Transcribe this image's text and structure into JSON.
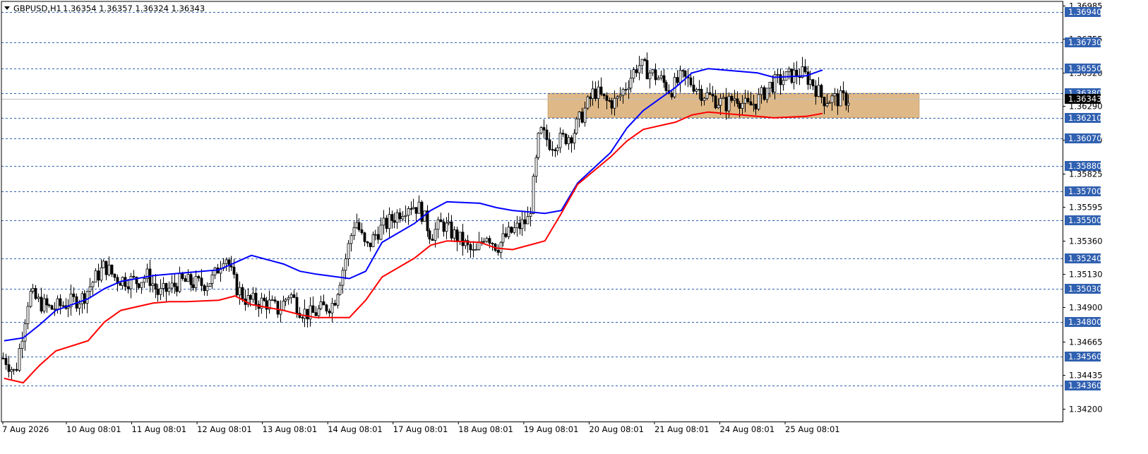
{
  "header": {
    "symbol": "GBPUSD,H1",
    "ohlc": "1.36354 1.36357 1.36324 1.36343"
  },
  "chart_data": {
    "type": "candlestick",
    "symbol": "GBPUSD",
    "timeframe": "H1",
    "last_price": "1.36343",
    "ylim": [
      1.4195,
      1.37095
    ],
    "y_ticks": [
      "1.36985",
      "1.36755",
      "1.36520",
      "1.36290",
      "1.36060",
      "1.35825",
      "1.35595",
      "1.35360",
      "1.35130",
      "1.34900",
      "1.34665",
      "1.34435",
      "1.34200"
    ],
    "x_ticks": [
      "7 Aug 2026",
      "10 Aug 08:01",
      "11 Aug 08:01",
      "12 Aug 08:01",
      "13 Aug 08:01",
      "14 Aug 08:01",
      "17 Aug 08:01",
      "18 Aug 08:01",
      "19 Aug 08:01",
      "20 Aug 08:01",
      "21 Aug 08:01",
      "24 Aug 08:01",
      "25 Aug 08:01"
    ],
    "levels": [
      "1.36940",
      "1.36730",
      "1.36550",
      "1.36380",
      "1.36210",
      "1.36070",
      "1.35880",
      "1.35700",
      "1.35500",
      "1.35240",
      "1.35030",
      "1.34800",
      "1.34560",
      "1.34360"
    ],
    "zone": {
      "from": 1.3638,
      "to": 1.3621
    },
    "colors": {
      "upper_ma": "#0000ff",
      "lower_ma": "#ff0000",
      "zone": "#deb887",
      "level_line": "#3060b0",
      "level_box": "#3060b0",
      "candles": "#000000"
    },
    "series": [
      {
        "kind": "ma",
        "color": "blue",
        "x": [
          "07 01:00",
          "07 08:00",
          "07 14:00",
          "07 20:00",
          "10 08:00",
          "10 14:00",
          "10 20:00",
          "11 08:00",
          "11 14:00",
          "11 20:00",
          "12 08:00",
          "12 14:00",
          "12 20:00",
          "13 08:00",
          "13 14:00",
          "13 20:00",
          "14 08:00",
          "14 14:00",
          "14 20:00",
          "17 08:00",
          "17 14:00",
          "17 20:00",
          "18 08:00",
          "18 14:00",
          "18 20:00",
          "19 08:00",
          "19 14:00",
          "19 20:00",
          "20 08:00",
          "20 14:00",
          "20 20:00",
          "21 08:00",
          "21 14:00",
          "21 20:00",
          "24 08:00",
          "24 14:00",
          "24 20:00",
          "25 08:00",
          "25 14:00"
        ],
        "y": [
          1.3467,
          1.3469,
          1.3478,
          1.3488,
          1.3496,
          1.3503,
          1.3508,
          1.3512,
          1.3513,
          1.3514,
          1.3516,
          1.3521,
          1.3526,
          1.352,
          1.3515,
          1.3513,
          1.351,
          1.3515,
          1.3535,
          1.3548,
          1.3557,
          1.3563,
          1.3562,
          1.3559,
          1.3557,
          1.3555,
          1.3557,
          1.3576,
          1.3597,
          1.3614,
          1.3626,
          1.3642,
          1.3652,
          1.3655,
          1.3653,
          1.3652,
          1.3649,
          1.365,
          1.3654
        ]
      },
      {
        "kind": "ma",
        "color": "red",
        "x": [
          "07 01:00",
          "07 08:00",
          "07 14:00",
          "07 20:00",
          "10 08:00",
          "10 14:00",
          "10 20:00",
          "11 08:00",
          "11 14:00",
          "11 20:00",
          "12 08:00",
          "12 14:00",
          "12 20:00",
          "13 08:00",
          "13 14:00",
          "13 20:00",
          "14 08:00",
          "14 14:00",
          "14 20:00",
          "17 08:00",
          "17 14:00",
          "17 20:00",
          "18 08:00",
          "18 14:00",
          "18 20:00",
          "19 08:00",
          "19 14:00",
          "19 20:00",
          "20 08:00",
          "20 14:00",
          "20 20:00",
          "21 08:00",
          "21 14:00",
          "21 20:00",
          "24 08:00",
          "24 14:00",
          "24 20:00",
          "25 08:00",
          "25 14:00"
        ],
        "y": [
          1.3441,
          1.3438,
          1.345,
          1.346,
          1.3467,
          1.348,
          1.3488,
          1.3493,
          1.3494,
          1.3494,
          1.3495,
          1.3498,
          1.3492,
          1.3488,
          1.3485,
          1.3483,
          1.3483,
          1.3495,
          1.3511,
          1.3524,
          1.3533,
          1.3536,
          1.3535,
          1.3531,
          1.353,
          1.3536,
          1.3555,
          1.3575,
          1.3594,
          1.3605,
          1.3613,
          1.3618,
          1.3623,
          1.3625,
          1.3623,
          1.3622,
          1.3621,
          1.3622,
          1.3624
        ]
      }
    ],
    "candles": [
      {
        "t": "07 01",
        "c": 1.3455
      },
      {
        "t": "07 05",
        "c": 1.3444
      },
      {
        "t": "07 10",
        "c": 1.35
      },
      {
        "t": "07 14",
        "c": 1.3493
      },
      {
        "t": "07 18",
        "c": 1.3489
      },
      {
        "t": "10 02",
        "c": 1.3494
      },
      {
        "t": "10 06",
        "c": 1.3497
      },
      {
        "t": "10 10",
        "c": 1.3509
      },
      {
        "t": "10 14",
        "c": 1.3519
      },
      {
        "t": "10 18",
        "c": 1.351
      },
      {
        "t": "11 02",
        "c": 1.3508
      },
      {
        "t": "11 06",
        "c": 1.3512
      },
      {
        "t": "11 10",
        "c": 1.3499
      },
      {
        "t": "11 14",
        "c": 1.3503
      },
      {
        "t": "11 18",
        "c": 1.3508
      },
      {
        "t": "12 02",
        "c": 1.3506
      },
      {
        "t": "12 06",
        "c": 1.351
      },
      {
        "t": "12 10",
        "c": 1.3528
      },
      {
        "t": "12 14",
        "c": 1.3505
      },
      {
        "t": "12 18",
        "c": 1.3495
      },
      {
        "t": "13 02",
        "c": 1.3493
      },
      {
        "t": "13 06",
        "c": 1.3488
      },
      {
        "t": "13 10",
        "c": 1.35
      },
      {
        "t": "13 14",
        "c": 1.3488
      },
      {
        "t": "13 18",
        "c": 1.3485
      },
      {
        "t": "14 02",
        "c": 1.3493
      },
      {
        "t": "14 06",
        "c": 1.352
      },
      {
        "t": "14 10",
        "c": 1.3552
      },
      {
        "t": "14 14",
        "c": 1.353
      },
      {
        "t": "14 18",
        "c": 1.3542
      },
      {
        "t": "17 02",
        "c": 1.3555
      },
      {
        "t": "17 06",
        "c": 1.3562
      },
      {
        "t": "17 10",
        "c": 1.3558
      },
      {
        "t": "17 14",
        "c": 1.354
      },
      {
        "t": "17 18",
        "c": 1.3548
      },
      {
        "t": "18 02",
        "c": 1.3534
      },
      {
        "t": "18 06",
        "c": 1.3526
      },
      {
        "t": "18 10",
        "c": 1.3542
      },
      {
        "t": "18 14",
        "c": 1.3532
      },
      {
        "t": "18 18",
        "c": 1.354
      },
      {
        "t": "19 02",
        "c": 1.3551
      },
      {
        "t": "19 06",
        "c": 1.3612
      },
      {
        "t": "19 10",
        "c": 1.3603
      },
      {
        "t": "19 14",
        "c": 1.3606
      },
      {
        "t": "19 18",
        "c": 1.361
      },
      {
        "t": "20 02",
        "c": 1.364
      },
      {
        "t": "20 06",
        "c": 1.3632
      },
      {
        "t": "20 10",
        "c": 1.3632
      },
      {
        "t": "20 14",
        "c": 1.3645
      },
      {
        "t": "20 18",
        "c": 1.3658
      },
      {
        "t": "21 02",
        "c": 1.3648
      },
      {
        "t": "21 06",
        "c": 1.364
      },
      {
        "t": "21 10",
        "c": 1.3649
      },
      {
        "t": "21 14",
        "c": 1.3645
      },
      {
        "t": "21 18",
        "c": 1.3638
      },
      {
        "t": "24 02",
        "c": 1.363
      },
      {
        "t": "24 06",
        "c": 1.3636
      },
      {
        "t": "24 10",
        "c": 1.3628
      },
      {
        "t": "24 14",
        "c": 1.3633
      },
      {
        "t": "24 18",
        "c": 1.3643
      },
      {
        "t": "25 02",
        "c": 1.365
      },
      {
        "t": "25 06",
        "c": 1.3652
      },
      {
        "t": "25 10",
        "c": 1.3646
      },
      {
        "t": "25 14",
        "c": 1.3634
      }
    ]
  }
}
